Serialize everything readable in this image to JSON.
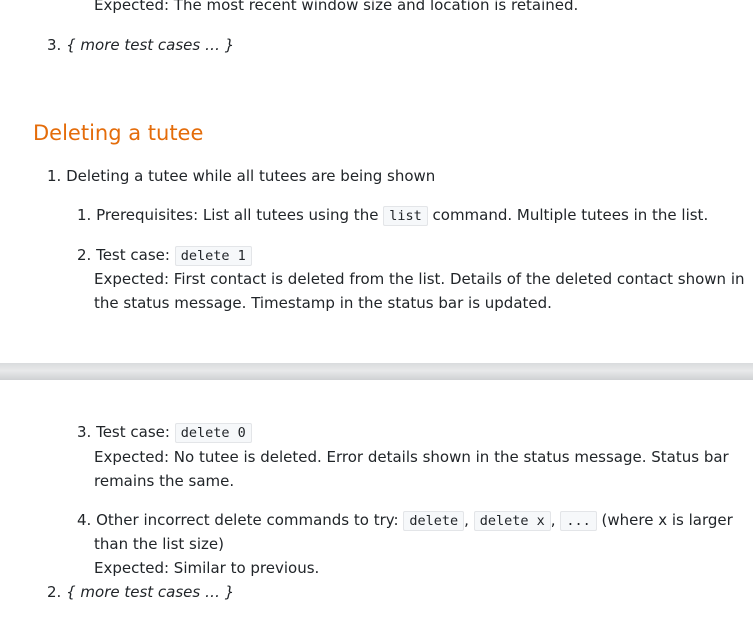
{
  "page1": {
    "top_expected": "Expected: The most recent window size and location is retained.",
    "item3_number": "3.",
    "item3_text": "{ more test cases … }",
    "heading": "Deleting a tutee",
    "item1_number": "1.",
    "item1_text": "Deleting a tutee while all tutees are being shown",
    "sub1_number": "1.",
    "sub1_prefix": "Prerequisites: List all tutees using the",
    "sub1_code": "list",
    "sub1_suffix": "command. Multiple tutees in the list.",
    "sub2_number": "2.",
    "sub2_prefix": "Test case:",
    "sub2_code": "delete 1",
    "sub2_expected_line1": "Expected: First contact is deleted from the list. Details of the deleted contact shown in",
    "sub2_expected_line2": "the status message. Timestamp in the status bar is updated."
  },
  "page2": {
    "sub3_number": "3.",
    "sub3_prefix": "Test case:",
    "sub3_code": "delete 0",
    "sub3_expected_line1": "Expected: No tutee is deleted. Error details shown in the status message. Status bar",
    "sub3_expected_line2": "remains the same.",
    "sub4_number": "4.",
    "sub4_prefix": "Other incorrect delete commands to try:",
    "sub4_code1": "delete",
    "sub4_sep1": ",",
    "sub4_code2": "delete x",
    "sub4_sep2": ",",
    "sub4_code3": "...",
    "sub4_suffix": "(where x is larger",
    "sub4_line2": "than the list size)",
    "sub4_expected": "Expected: Similar to previous.",
    "item2_number": "2.",
    "item2_text": "{ more test cases … }"
  }
}
